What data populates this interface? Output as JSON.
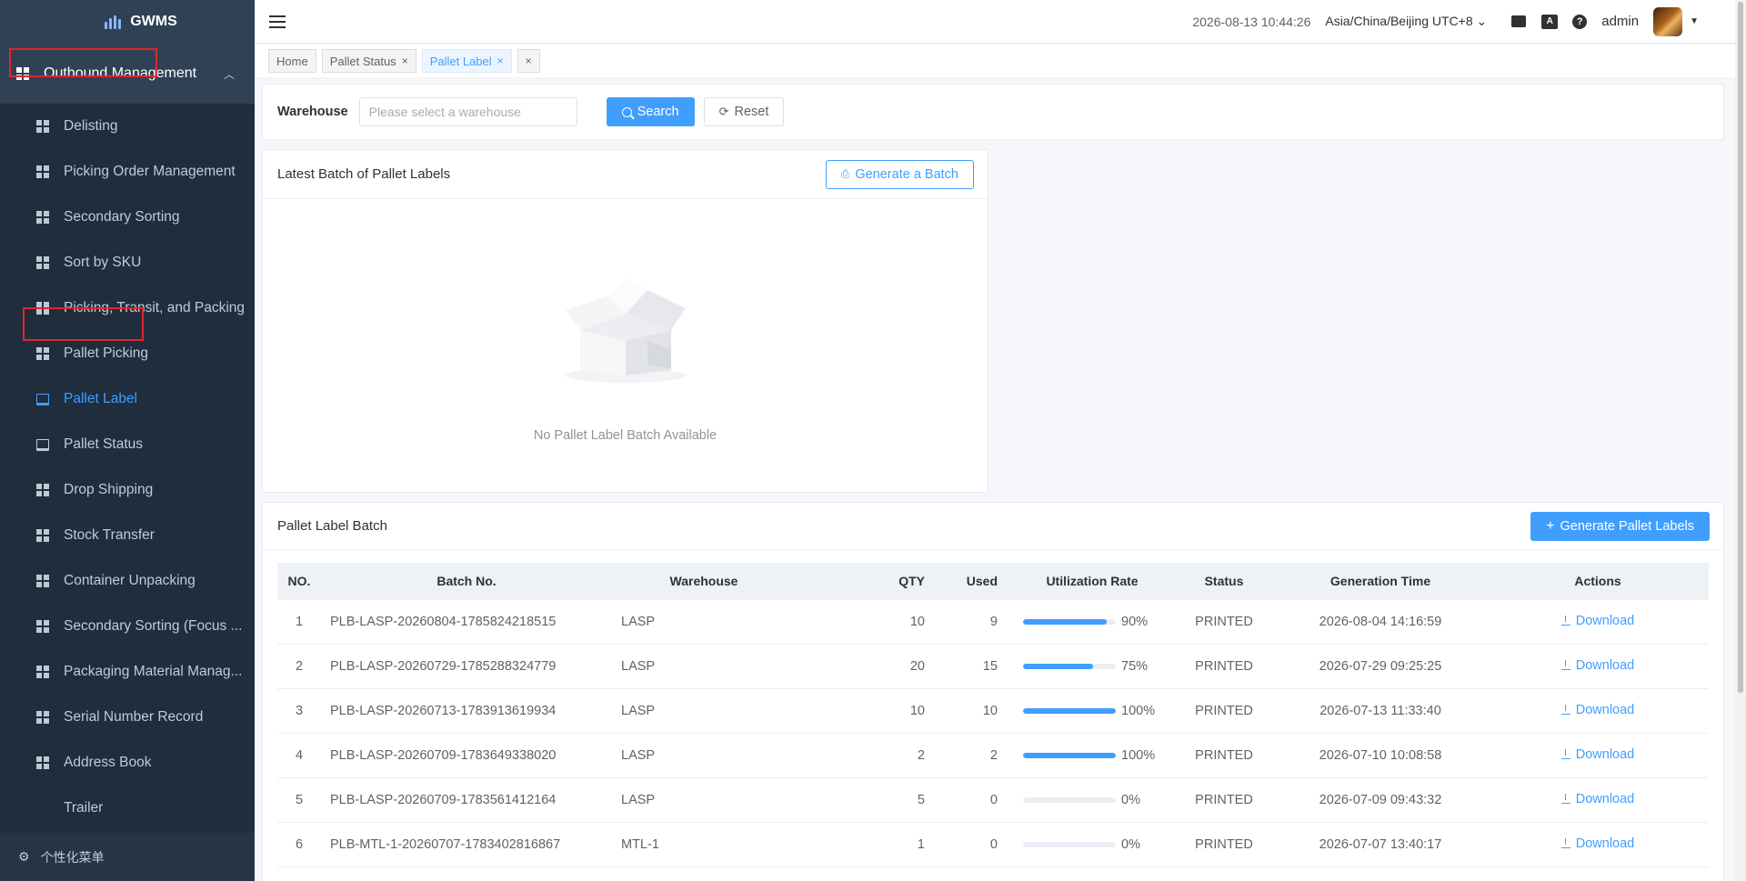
{
  "app": {
    "name": "GWMS"
  },
  "sidebar": {
    "parent": {
      "label": "Outbound Management"
    },
    "items": [
      {
        "label": "Delisting",
        "icon": "grid-icon"
      },
      {
        "label": "Picking Order Management",
        "icon": "grid-icon"
      },
      {
        "label": "Secondary Sorting",
        "icon": "grid-icon"
      },
      {
        "label": "Sort by SKU",
        "icon": "grid-icon"
      },
      {
        "label": "Picking, Transit, and Packing",
        "icon": "grid-icon"
      },
      {
        "label": "Pallet Picking",
        "icon": "grid-icon"
      },
      {
        "label": "Pallet Label",
        "icon": "pallet-icon",
        "active": true
      },
      {
        "label": "Pallet Status",
        "icon": "pallet-icon"
      },
      {
        "label": "Drop Shipping",
        "icon": "grid-icon"
      },
      {
        "label": "Stock Transfer",
        "icon": "grid-icon"
      },
      {
        "label": "Container Unpacking",
        "icon": "grid-icon"
      },
      {
        "label": "Secondary Sorting (Focus ...",
        "icon": "grid-icon"
      },
      {
        "label": "Packaging Material Manag...",
        "icon": "grid-icon"
      },
      {
        "label": "Serial Number Record",
        "icon": "grid-icon"
      },
      {
        "label": "Address Book",
        "icon": "grid-icon"
      },
      {
        "label": "Trailer",
        "icon": ""
      }
    ],
    "footer": {
      "label": "个性化菜单"
    }
  },
  "header": {
    "datetime": "2026-08-13 10:44:26",
    "timezone": "Asia/China/Beijing UTC+8",
    "az_label": "A",
    "help_label": "?",
    "user": "admin"
  },
  "tabs": [
    {
      "label": "Home"
    },
    {
      "label": "Pallet Status"
    },
    {
      "label": "Pallet Label",
      "active": true
    }
  ],
  "search": {
    "warehouse_label": "Warehouse",
    "warehouse_placeholder": "Please select a warehouse",
    "search_label": "Search",
    "reset_label": "Reset"
  },
  "latest": {
    "title": "Latest Batch of Pallet Labels",
    "generate_label": "Generate a Batch",
    "empty_text": "No Pallet Label Batch Available"
  },
  "batches": {
    "title": "Pallet Label Batch",
    "generate_label": "Generate Pallet Labels",
    "columns": [
      "NO.",
      "Batch No.",
      "Warehouse",
      "QTY",
      "Used",
      "Utilization Rate",
      "Status",
      "Generation Time",
      "Actions"
    ],
    "action_label": "Download",
    "rows": [
      {
        "no": "1",
        "batch": "PLB-LASP-20260804-1785824218515",
        "warehouse": "LASP",
        "qty": "10",
        "used": "9",
        "rate": 90,
        "rate_label": "90%",
        "status": "PRINTED",
        "time": "2026-08-04 14:16:59"
      },
      {
        "no": "2",
        "batch": "PLB-LASP-20260729-1785288324779",
        "warehouse": "LASP",
        "qty": "20",
        "used": "15",
        "rate": 75,
        "rate_label": "75%",
        "status": "PRINTED",
        "time": "2026-07-29 09:25:25"
      },
      {
        "no": "3",
        "batch": "PLB-LASP-20260713-1783913619934",
        "warehouse": "LASP",
        "qty": "10",
        "used": "10",
        "rate": 100,
        "rate_label": "100%",
        "status": "PRINTED",
        "time": "2026-07-13 11:33:40"
      },
      {
        "no": "4",
        "batch": "PLB-LASP-20260709-1783649338020",
        "warehouse": "LASP",
        "qty": "2",
        "used": "2",
        "rate": 100,
        "rate_label": "100%",
        "status": "PRINTED",
        "time": "2026-07-10 10:08:58"
      },
      {
        "no": "5",
        "batch": "PLB-LASP-20260709-1783561412164",
        "warehouse": "LASP",
        "qty": "5",
        "used": "0",
        "rate": 0,
        "rate_label": "0%",
        "status": "PRINTED",
        "time": "2026-07-09 09:43:32"
      },
      {
        "no": "6",
        "batch": "PLB-MTL-1-20260707-1783402816867",
        "warehouse": "MTL-1",
        "qty": "1",
        "used": "0",
        "rate": 0,
        "rate_label": "0%",
        "status": "PRINTED",
        "time": "2026-07-07 13:40:17"
      }
    ]
  },
  "colors": {
    "primary": "#409eff",
    "sidebar_bg": "#304156",
    "submenu_bg": "#1f2d3d",
    "highlight": "#e0262d"
  }
}
